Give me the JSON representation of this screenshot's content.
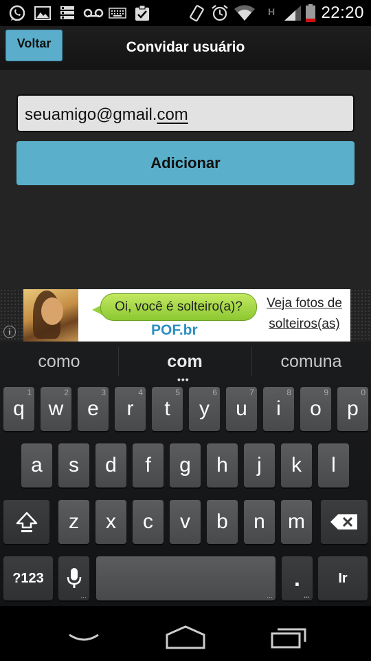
{
  "status_bar": {
    "time": "22:20",
    "network_label": "H",
    "icons": [
      "whatsapp-icon",
      "gallery-icon",
      "storage-icon",
      "voicemail-icon",
      "keyboard-icon",
      "clipboard-icon",
      "vibrate-icon",
      "alarm-icon",
      "wifi-icon",
      "signal-icon",
      "battery-icon"
    ]
  },
  "action_bar": {
    "back_label": "Voltar",
    "title": "Convidar usuário"
  },
  "form": {
    "email_value_prefix": "seuamigo@gmail.",
    "email_value_composing": "com",
    "add_label": "Adicionar"
  },
  "ad": {
    "bubble_text": "Oi, você é solteiro(a)?",
    "brand": "POF.br",
    "cta_line1": "Veja fotos de",
    "cta_line2": "solteiros(as)",
    "info_symbol": "i"
  },
  "keyboard": {
    "suggestions": [
      "como",
      "com",
      "comuna"
    ],
    "row1": [
      {
        "k": "q",
        "h": "1"
      },
      {
        "k": "w",
        "h": "2"
      },
      {
        "k": "e",
        "h": "3"
      },
      {
        "k": "r",
        "h": "4"
      },
      {
        "k": "t",
        "h": "5"
      },
      {
        "k": "y",
        "h": "6"
      },
      {
        "k": "u",
        "h": "7"
      },
      {
        "k": "i",
        "h": "8"
      },
      {
        "k": "o",
        "h": "9"
      },
      {
        "k": "p",
        "h": "0"
      }
    ],
    "row2": [
      "a",
      "s",
      "d",
      "f",
      "g",
      "h",
      "j",
      "k",
      "l"
    ],
    "row3": [
      "z",
      "x",
      "c",
      "v",
      "b",
      "n",
      "m"
    ],
    "symbols_label": "?123",
    "period_label": ".",
    "go_label": "Ir"
  },
  "colors": {
    "accent": "#5ab0ca",
    "background": "#242424",
    "key": "#505153"
  }
}
